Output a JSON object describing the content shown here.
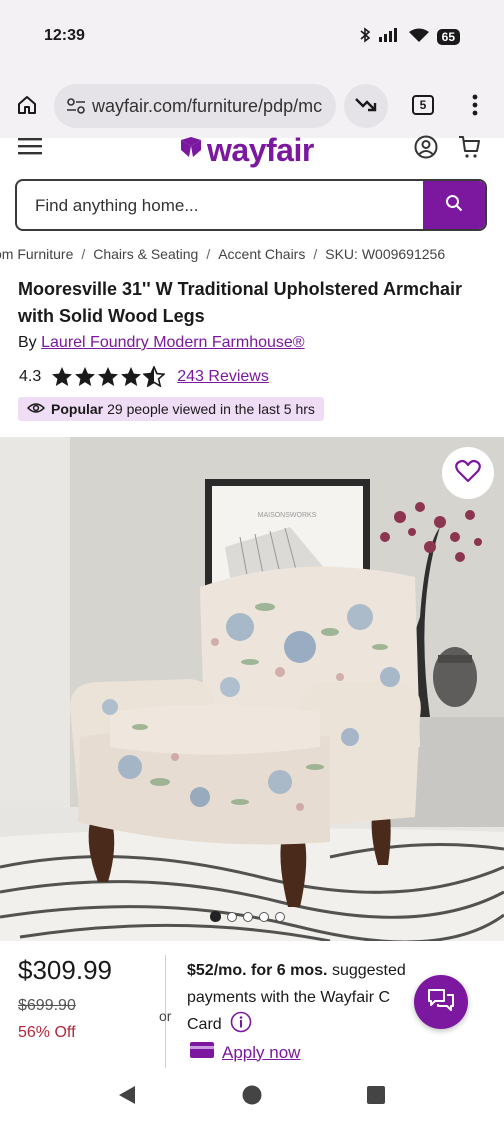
{
  "status_bar": {
    "time": "12:39",
    "battery": "65"
  },
  "browser": {
    "url": "wayfair.com/furniture/pdp/mc",
    "tab_count": "5"
  },
  "header": {
    "logo_text": "wayfair"
  },
  "search": {
    "placeholder": "Find anything home..."
  },
  "breadcrumbs": [
    "om Furniture",
    "Chairs & Seating",
    "Accent Chairs",
    "SKU: W009691256"
  ],
  "product": {
    "title": "Mooresville 31'' W Traditional Upholstered Armchair with Solid Wood Legs",
    "by_prefix": "By",
    "brand": "Laurel Foundry Modern Farmhouse®",
    "rating": "4.3",
    "stars_value": 4.3,
    "reviews": "243 Reviews",
    "popular_label": "Popular",
    "popular_text": "29 people viewed in the last 5 hrs"
  },
  "gallery": {
    "image_count": 5,
    "active_index": 0,
    "poster_text": "MAISONSWORKS"
  },
  "pricing": {
    "price": "$309.99",
    "old_price": "$699.90",
    "discount": "56% Off",
    "or_text": "or",
    "monthly_bold": "$52/mo. for 6 mos.",
    "monthly_rest": " suggested payments with the Wayfair C",
    "card_label": "Card",
    "apply_label": "Apply now"
  },
  "colors": {
    "brand": "#7b189f",
    "discount": "#b0263b",
    "badge_bg": "#efdcf5"
  }
}
